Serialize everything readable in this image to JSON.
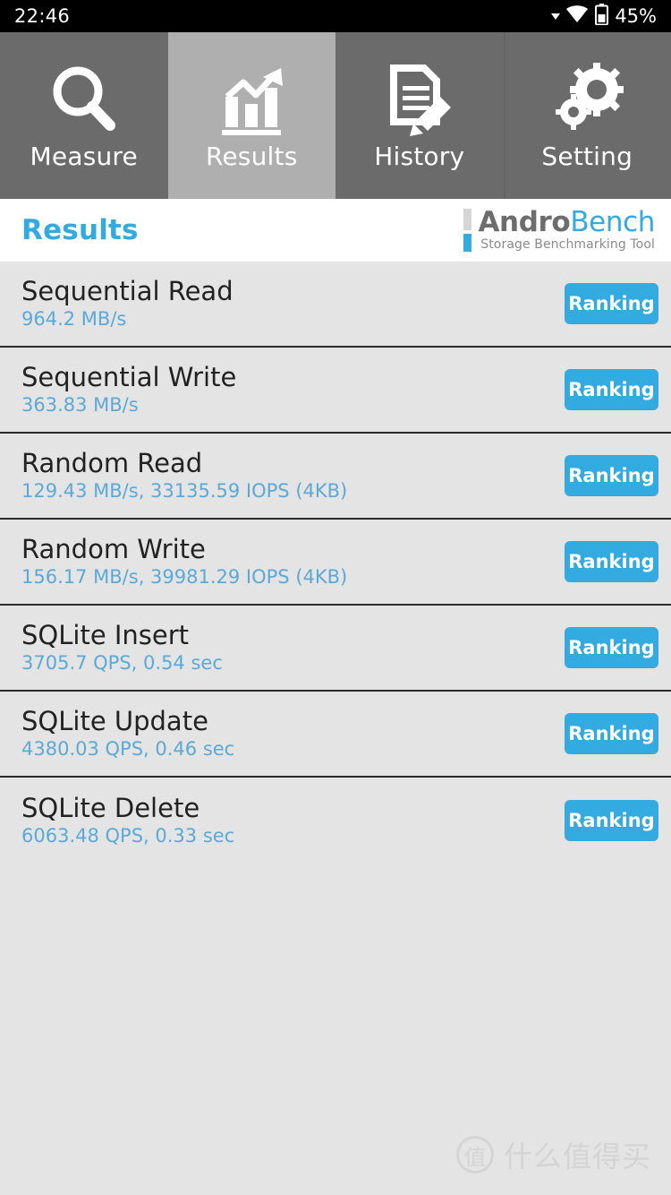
{
  "statusbar": {
    "time": "22:46",
    "battery_percent": "45%",
    "icons": [
      "caret-down-icon",
      "wifi-icon",
      "battery-icon"
    ]
  },
  "tabs": [
    {
      "label": "Measure",
      "icon": "magnifier-icon",
      "active": false
    },
    {
      "label": "Results",
      "icon": "bar-chart-trend-icon",
      "active": true
    },
    {
      "label": "History",
      "icon": "document-pencil-icon",
      "active": false
    },
    {
      "label": "Setting",
      "icon": "gears-icon",
      "active": false
    }
  ],
  "header": {
    "title": "Results",
    "logo_primary": "Andro",
    "logo_secondary": "Bench",
    "logo_subtitle": "Storage Benchmarking Tool"
  },
  "colors": {
    "accent_blue": "#33aae0",
    "value_blue": "#5aa9d6",
    "tab_inactive": "#6b6b6b",
    "tab_active": "#afafaf",
    "list_bg": "#e4e4e4",
    "divider": "#2a2a2a"
  },
  "results": {
    "button_label": "Ranking",
    "rows": [
      {
        "name": "Sequential Read",
        "value": "964.2 MB/s"
      },
      {
        "name": "Sequential Write",
        "value": "363.83 MB/s"
      },
      {
        "name": "Random Read",
        "value": "129.43 MB/s, 33135.59 IOPS (4KB)"
      },
      {
        "name": "Random Write",
        "value": "156.17 MB/s, 39981.29 IOPS (4KB)"
      },
      {
        "name": "SQLite Insert",
        "value": "3705.7 QPS, 0.54 sec"
      },
      {
        "name": "SQLite Update",
        "value": "4380.03 QPS, 0.46 sec"
      },
      {
        "name": "SQLite Delete",
        "value": "6063.48 QPS, 0.33 sec"
      }
    ]
  },
  "watermark": {
    "logo_char": "值",
    "text": "什么值得买"
  }
}
